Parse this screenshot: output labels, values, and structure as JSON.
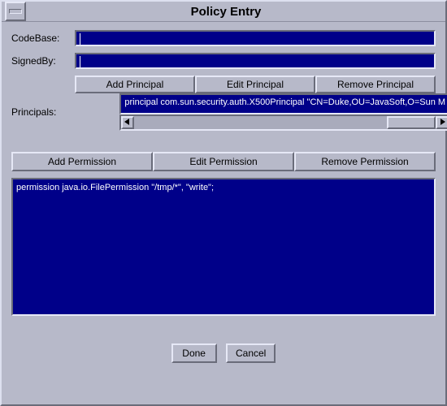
{
  "window": {
    "title": "Policy Entry"
  },
  "labels": {
    "codebase": "CodeBase:",
    "signedby": "SignedBy:",
    "principals": "Principals:"
  },
  "fields": {
    "codebase": "",
    "signedby": ""
  },
  "principal_buttons": {
    "add": "Add Principal",
    "edit": "Edit Principal",
    "remove": "Remove Principal"
  },
  "principals": [
    "principal com.sun.security.auth.X500Principal \"CN=Duke,OU=JavaSoft,O=Sun M"
  ],
  "permission_buttons": {
    "add": "Add Permission",
    "edit": "Edit Permission",
    "remove": "Remove Permission"
  },
  "permissions": [
    "permission java.io.FilePermission \"/tmp/*\", \"write\";"
  ],
  "footer": {
    "done": "Done",
    "cancel": "Cancel"
  }
}
